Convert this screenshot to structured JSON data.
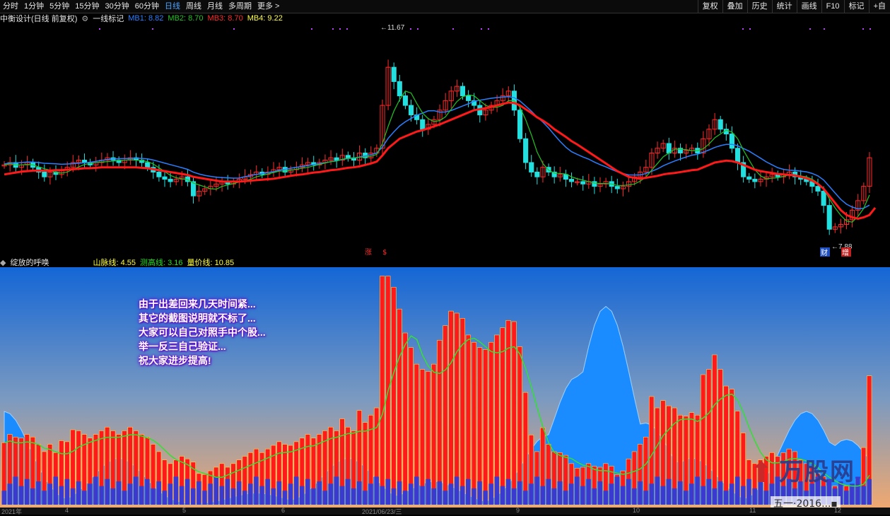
{
  "toolbar": {
    "periods": [
      "分时",
      "1分钟",
      "5分钟",
      "15分钟",
      "30分钟",
      "60分钟",
      "日线",
      "周线",
      "月线",
      "多周期",
      "更多 >"
    ],
    "active_period": "日线",
    "right_buttons": [
      "复权",
      "叠加",
      "历史",
      "统计",
      "画线",
      "F10",
      "标记",
      "+自"
    ]
  },
  "main_legend": {
    "name": "中衡设计(日线 前复权)",
    "indicator": "一线标记",
    "mb1": {
      "label": "MB1: 8.82",
      "color": "#2a7fff"
    },
    "mb2": {
      "label": "MB2: 8.70",
      "color": "#22c322"
    },
    "mb3": {
      "label": "MB3: 8.70",
      "color": "#ff2a2a"
    },
    "mb4": {
      "label": "MB4: 9.22",
      "color": "#ffff40"
    }
  },
  "price_annotations": {
    "high": "11.67",
    "low": "7.88",
    "bottom_left": "涨",
    "bottom_mid": "$",
    "fin_left": "财",
    "fin_right": "增"
  },
  "sub_legend": {
    "name": "绽放的呼唤",
    "shan": {
      "label": "山脉线: 4.55",
      "color": "#ffff40"
    },
    "ce": {
      "label": "测高线: 3.16",
      "color": "#22e022"
    },
    "liang": {
      "label": "量价线: 10.85",
      "color": "#ffff40"
    }
  },
  "note_lines": [
    "由于出差回来几天时间紧...",
    "其它的截图说明就不标了...",
    "大家可以自己对照手中个股...",
    "举一反三自己验证...",
    "祝大家进步提高!"
  ],
  "watermark": {
    "text": "万股网",
    "sub": "五一·2016...▪"
  },
  "date_axis": [
    "2021年",
    "4",
    "5",
    "6",
    "2021/06/23/三",
    "9",
    "10",
    "11",
    "12"
  ],
  "colors": {
    "up": "#ff2a2a",
    "down": "#22e0e0",
    "ma_red": "#ff1a1a",
    "ma_blue": "#2a7fff",
    "ma_green": "#22c322",
    "bar_red": "#ff1a1a",
    "bar_stroke": "#ffd24a",
    "area_blue": "#1a8cff",
    "line_green": "#33e033",
    "vol_blue": "#3a3ad0"
  },
  "chart_data": {
    "type": "line",
    "title": "",
    "price_range": [
      7.4,
      12.0
    ],
    "close": [
      9.25,
      9.3,
      9.2,
      9.25,
      9.3,
      9.2,
      9.1,
      9.0,
      9.1,
      9.05,
      9.15,
      9.2,
      9.3,
      9.35,
      9.3,
      9.25,
      9.3,
      9.35,
      9.4,
      9.35,
      9.3,
      9.35,
      9.4,
      9.35,
      9.3,
      9.2,
      9.1,
      9.0,
      8.95,
      8.9,
      8.95,
      9.0,
      8.9,
      8.6,
      8.7,
      8.75,
      8.8,
      8.85,
      8.9,
      8.85,
      8.9,
      8.95,
      9.0,
      9.05,
      9.1,
      9.05,
      9.1,
      9.15,
      9.2,
      9.1,
      9.15,
      9.2,
      9.25,
      9.3,
      9.25,
      9.3,
      9.35,
      9.4,
      9.35,
      9.45,
      9.4,
      9.35,
      9.5,
      9.4,
      9.5,
      9.6,
      10.5,
      11.3,
      11.0,
      10.7,
      10.5,
      10.3,
      10.2,
      10.0,
      10.1,
      10.2,
      10.4,
      10.6,
      10.8,
      10.9,
      10.7,
      10.6,
      10.5,
      10.3,
      10.4,
      10.5,
      10.6,
      10.7,
      10.8,
      10.4,
      9.8,
      9.3,
      9.1,
      9.0,
      9.2,
      9.1,
      9.0,
      9.05,
      8.95,
      8.9,
      8.9,
      8.85,
      8.9,
      8.8,
      8.85,
      8.9,
      8.8,
      8.75,
      8.8,
      8.9,
      9.0,
      9.1,
      9.2,
      9.5,
      9.6,
      9.7,
      9.5,
      9.6,
      9.5,
      9.55,
      9.6,
      9.5,
      9.8,
      10.0,
      10.2,
      10.0,
      9.9,
      9.6,
      9.3,
      9.0,
      8.95,
      8.9,
      8.95,
      9.0,
      9.05,
      9.0,
      9.05,
      9.1,
      9.0,
      8.95,
      8.9,
      8.8,
      8.7,
      8.4,
      7.9,
      7.95,
      8.0,
      8.1,
      8.3,
      8.5,
      8.8,
      9.4
    ],
    "ma_red": [
      9.05,
      9.07,
      9.09,
      9.11,
      9.12,
      9.13,
      9.13,
      9.13,
      9.13,
      9.14,
      9.14,
      9.15,
      9.16,
      9.17,
      9.18,
      9.18,
      9.19,
      9.2,
      9.2,
      9.2,
      9.2,
      9.2,
      9.2,
      9.2,
      9.19,
      9.18,
      9.16,
      9.14,
      9.12,
      9.1,
      9.08,
      9.06,
      9.04,
      9.0,
      8.98,
      8.96,
      8.94,
      8.92,
      8.9,
      8.9,
      8.9,
      8.9,
      8.91,
      8.92,
      8.93,
      8.94,
      8.95,
      8.96,
      8.98,
      9.0,
      9.02,
      9.04,
      9.05,
      9.07,
      9.09,
      9.1,
      9.12,
      9.14,
      9.15,
      9.17,
      9.19,
      9.2,
      9.22,
      9.25,
      9.28,
      9.32,
      9.45,
      9.6,
      9.7,
      9.8,
      9.85,
      9.9,
      9.95,
      9.98,
      10.02,
      10.06,
      10.1,
      10.15,
      10.2,
      10.25,
      10.3,
      10.35,
      10.4,
      10.42,
      10.44,
      10.47,
      10.5,
      10.53,
      10.56,
      10.55,
      10.5,
      10.42,
      10.34,
      10.25,
      10.18,
      10.1,
      10.0,
      9.92,
      9.84,
      9.75,
      9.68,
      9.6,
      9.52,
      9.44,
      9.36,
      9.28,
      9.2,
      9.12,
      9.06,
      9.0,
      8.98,
      8.96,
      8.98,
      9.0,
      9.02,
      9.05,
      9.07,
      9.08,
      9.1,
      9.12,
      9.14,
      9.15,
      9.2,
      9.25,
      9.3,
      9.32,
      9.34,
      9.33,
      9.3,
      9.25,
      9.2,
      9.15,
      9.12,
      9.1,
      9.08,
      9.06,
      9.05,
      9.04,
      9.03,
      9.0,
      8.97,
      8.92,
      8.85,
      8.75,
      8.6,
      8.45,
      8.3,
      8.2,
      8.15,
      8.12,
      8.15,
      8.2,
      8.35
    ]
  }
}
